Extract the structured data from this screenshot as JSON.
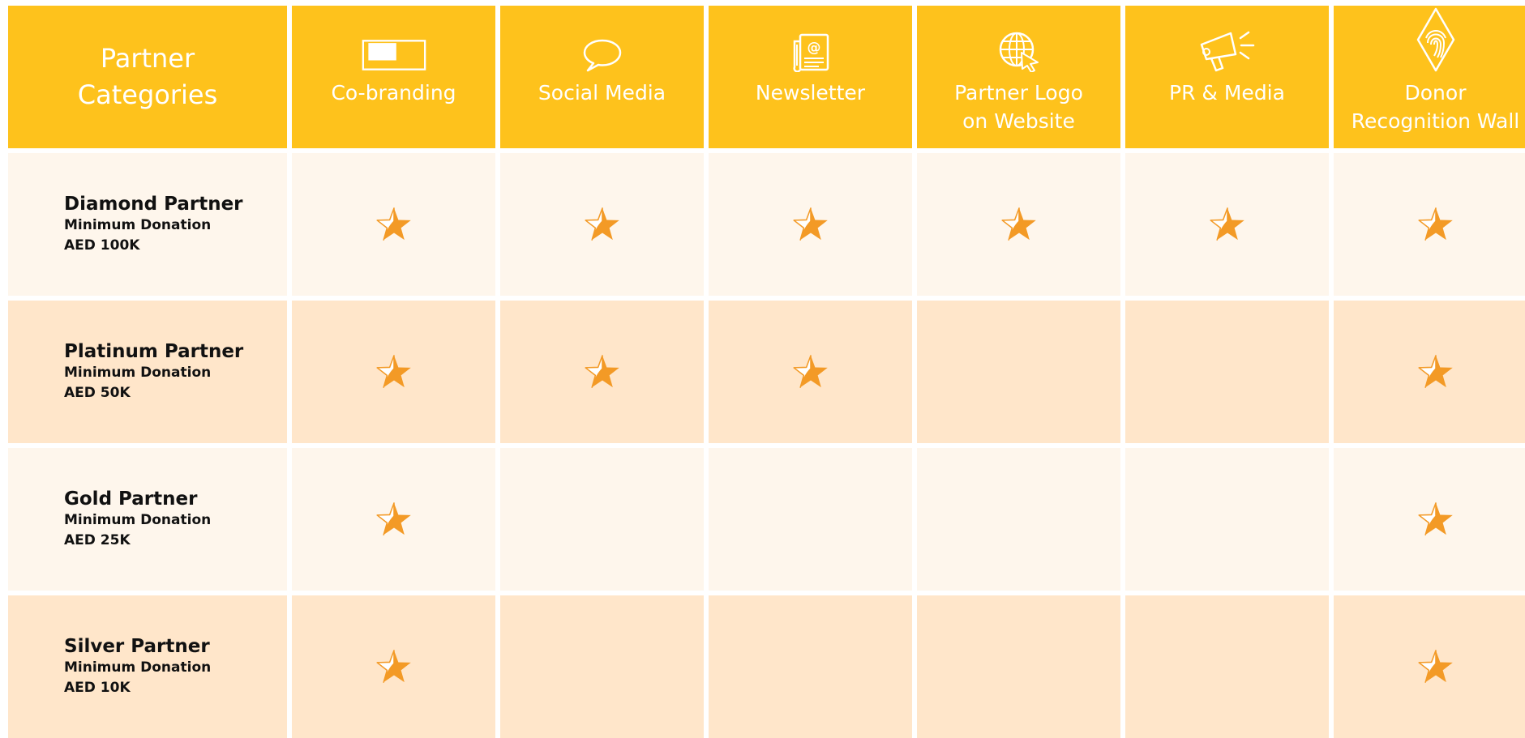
{
  "header": {
    "categories_label": "Partner\nCategories",
    "columns": [
      {
        "label": "Co-branding",
        "icon": "co-branding-icon"
      },
      {
        "label": "Social Media",
        "icon": "speech-bubble-icon"
      },
      {
        "label": "Newsletter",
        "icon": "newsletter-icon"
      },
      {
        "label": "Partner Logo\non Website",
        "icon": "globe-cursor-icon"
      },
      {
        "label": "PR & Media",
        "icon": "megaphone-icon"
      },
      {
        "label": "Donor\nRecognition Wall",
        "icon": "fingerprint-icon"
      }
    ]
  },
  "rows": [
    {
      "tier": "Diamond Partner",
      "note": "Minimum Donation",
      "amount": "AED 100K",
      "benefits": [
        true,
        true,
        true,
        true,
        true,
        true
      ]
    },
    {
      "tier": "Platinum Partner",
      "note": "Minimum Donation",
      "amount": "AED 50K",
      "benefits": [
        true,
        true,
        true,
        false,
        false,
        true
      ]
    },
    {
      "tier": "Gold Partner",
      "note": "Minimum Donation",
      "amount": "AED 25K",
      "benefits": [
        true,
        false,
        false,
        false,
        false,
        true
      ]
    },
    {
      "tier": "Silver Partner",
      "note": "Minimum Donation",
      "amount": "AED 10K",
      "benefits": [
        true,
        false,
        false,
        false,
        false,
        true
      ]
    }
  ],
  "colors": {
    "header_bg": "#fec21c",
    "row_light": "#fef6ec",
    "row_dark": "#ffe6ca",
    "star": "#f39a26"
  }
}
